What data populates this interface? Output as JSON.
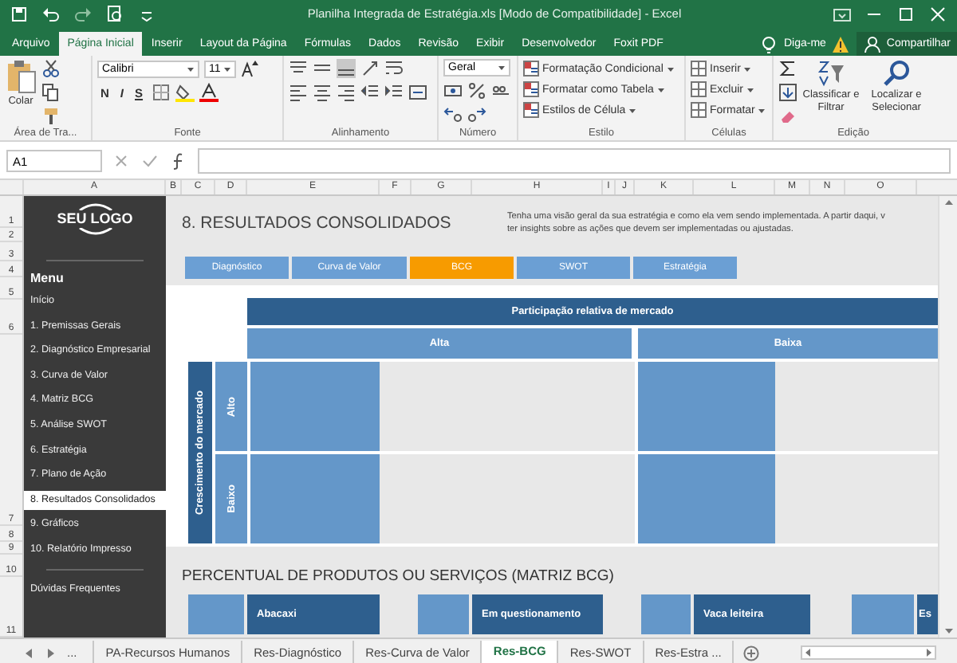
{
  "window": {
    "title": "Planilha Integrada de Estratégia.xls  [Modo de Compatibilidade] - Excel"
  },
  "ribbon_tabs": [
    {
      "label": "Arquivo",
      "selected": false
    },
    {
      "label": "Página Inicial",
      "selected": true
    },
    {
      "label": "Inserir",
      "selected": false
    },
    {
      "label": "Layout da Página",
      "selected": false
    },
    {
      "label": "Fórmulas",
      "selected": false
    },
    {
      "label": "Dados",
      "selected": false
    },
    {
      "label": "Revisão",
      "selected": false
    },
    {
      "label": "Exibir",
      "selected": false
    },
    {
      "label": "Desenvolvedor",
      "selected": false
    },
    {
      "label": "Foxit PDF",
      "selected": false
    }
  ],
  "tell_me": "Diga-me",
  "share": "Compartilhar",
  "ribbon": {
    "clipboard": {
      "paste": "Colar",
      "label": "Área de Tra..."
    },
    "font": {
      "name": "Calibri",
      "size": "11",
      "bold": "N",
      "italic": "I",
      "underline": "S",
      "label": "Fonte"
    },
    "alignment": {
      "label": "Alinhamento"
    },
    "number": {
      "format": "Geral",
      "label": "Número"
    },
    "styles": {
      "items": [
        "Formatação Condicional",
        "Formatar como Tabela",
        "Estilos de Célula"
      ],
      "label": "Estilo"
    },
    "cells": {
      "items": [
        "Inserir",
        "Excluir",
        "Formatar"
      ],
      "label": "Células"
    },
    "editing": {
      "sort": "Classificar e Filtrar",
      "find": "Localizar e Selecionar",
      "label": "Edição"
    }
  },
  "formula_bar": {
    "name_box": "A1"
  },
  "columns": [
    "A",
    "B",
    "C",
    "D",
    "E",
    "F",
    "G",
    "H",
    "I",
    "J",
    "K",
    "L",
    "M",
    "N",
    "O"
  ],
  "rows": [
    "1",
    "2",
    "3",
    "4",
    "5",
    "6",
    "7",
    "8",
    "9",
    "10",
    "11"
  ],
  "sidebar": {
    "logo": "SEU LOGO",
    "menu_title": "Menu",
    "items": [
      {
        "label": "Início",
        "selected": false
      },
      {
        "label": "1. Premissas Gerais",
        "selected": false
      },
      {
        "label": "2. Diagnóstico Empresarial",
        "selected": false
      },
      {
        "label": "3. Curva de Valor",
        "selected": false
      },
      {
        "label": "4. Matriz BCG",
        "selected": false
      },
      {
        "label": "5. Análise SWOT",
        "selected": false
      },
      {
        "label": "6. Estratégia",
        "selected": false
      },
      {
        "label": "7. Plano de Ação",
        "selected": false
      },
      {
        "label": "8. Resultados Consolidados",
        "selected": true
      },
      {
        "label": "9. Gráficos",
        "selected": false
      },
      {
        "label": "10. Relatório Impresso",
        "selected": false
      }
    ],
    "footer": "Dúvidas Frequentes"
  },
  "sheet": {
    "title": "8. RESULTADOS CONSOLIDADOS",
    "description": [
      "Tenha uma visão geral da sua estratégia e como ela vem sendo implementada. A partir daqui, v",
      "ter insights sobre as ações que devem ser implementadas ou ajustadas."
    ],
    "nav": [
      {
        "label": "Diagnóstico",
        "selected": false
      },
      {
        "label": "Curva de Valor",
        "selected": false
      },
      {
        "label": "BCG",
        "selected": true
      },
      {
        "label": "SWOT",
        "selected": false
      },
      {
        "label": "Estratégia",
        "selected": false
      }
    ],
    "matrix": {
      "x_title": "Participação relativa de mercado",
      "columns": [
        "Alta",
        "Baixa"
      ],
      "y_title": "Crescimento do mercado",
      "rows": [
        "Alto",
        "Baixo"
      ]
    },
    "section_title": "PERCENTUAL DE PRODUTOS OU SERVIÇOS (MATRIZ BCG)",
    "categories": [
      "Abacaxi",
      "Em questionamento",
      "Vaca leiteira",
      "Es"
    ]
  },
  "sheet_tabs": [
    {
      "label": "PA-Recursos Humanos",
      "selected": false
    },
    {
      "label": "Res-Diagnóstico",
      "selected": false
    },
    {
      "label": "Res-Curva de Valor",
      "selected": false
    },
    {
      "label": "Res-BCG",
      "selected": true
    },
    {
      "label": "Res-SWOT",
      "selected": false
    },
    {
      "label": "Res-Estra ...",
      "selected": false
    }
  ],
  "sheet_nav_more": "..."
}
